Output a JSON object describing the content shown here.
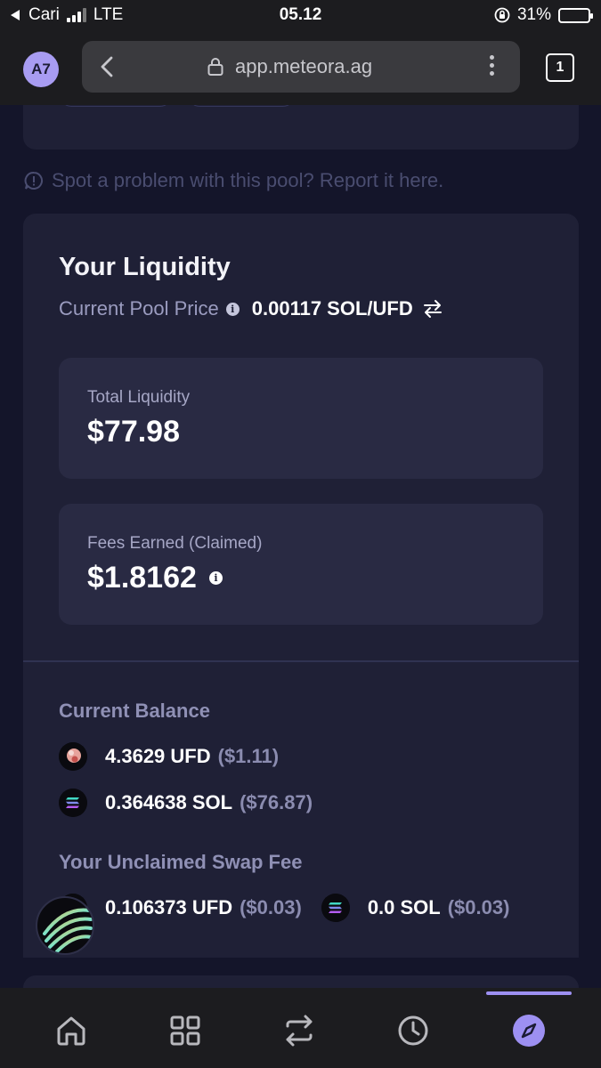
{
  "status_bar": {
    "carrier": "Cari",
    "network": "LTE",
    "time": "05.12",
    "battery_percent": "31%",
    "battery_level": 0.31
  },
  "browser": {
    "avatar_initials": "A7",
    "url": "app.meteora.ag",
    "tab_count": "1"
  },
  "report_text": "Spot a problem with this pool? Report it here.",
  "liquidity": {
    "title": "Your Liquidity",
    "pool_price_label": "Current Pool Price",
    "pool_price_value": "0.00117 SOL/UFD",
    "total_liquidity_label": "Total Liquidity",
    "total_liquidity_value": "$77.98",
    "fees_earned_label": "Fees Earned (Claimed)",
    "fees_earned_value": "$1.8162"
  },
  "current_balance": {
    "title": "Current Balance",
    "items": [
      {
        "amount": "4.3629 UFD",
        "usd": "($1.11)"
      },
      {
        "amount": "0.364638 SOL",
        "usd": "($76.87)"
      }
    ]
  },
  "unclaimed": {
    "title": "Your Unclaimed Swap Fee",
    "items": [
      {
        "amount": "0.106373 UFD",
        "usd": "($0.03)"
      },
      {
        "amount": "0.0 SOL",
        "usd": "($0.03)"
      }
    ]
  },
  "colors": {
    "accent": "#9d90f2",
    "card": "#1f2036",
    "inner_card": "#292a43",
    "background": "#14152a"
  }
}
